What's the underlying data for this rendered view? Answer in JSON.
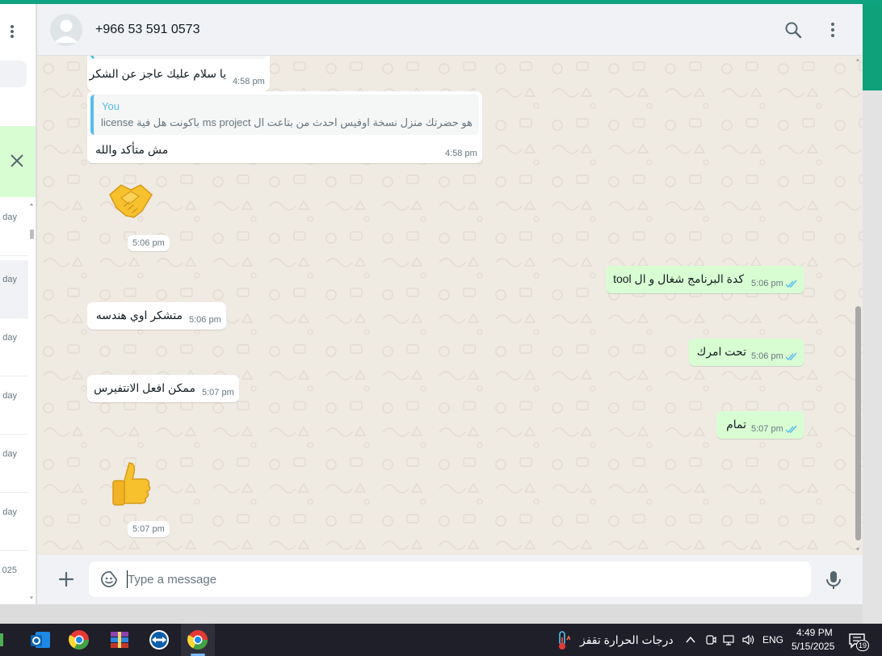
{
  "header": {
    "contact_name": "+966 53 591 0573"
  },
  "sidebar": {
    "dates": [
      "day",
      "day",
      "day",
      "day",
      "day",
      "day",
      "025"
    ]
  },
  "messages": [
    {
      "dir": "in",
      "text": "يا سلام عليك عاجز عن الشكر",
      "time": "4:58 pm"
    },
    {
      "dir": "in",
      "quote_author": "You",
      "quote_text": "هو حضرتك منزل نسخة اوفيس احدث من بتاعت ال ms project باكونت هل فية license",
      "text": "مش متأكد والله",
      "time": "4:58 pm"
    },
    {
      "dir": "in",
      "emoji": "handshake",
      "time": "5:06 pm"
    },
    {
      "dir": "out",
      "text": "كدة البرنامج شغال و ال tool",
      "time": "5:06 pm"
    },
    {
      "dir": "in",
      "text": "متشكر اوي هندسه",
      "time": "5:06 pm"
    },
    {
      "dir": "out",
      "text": "تحت امرك",
      "time": "5:06 pm"
    },
    {
      "dir": "in",
      "text": "ممكن افعل الانتفيرس",
      "time": "5:07 pm"
    },
    {
      "dir": "out",
      "text": "تمام",
      "time": "5:07 pm"
    },
    {
      "dir": "in",
      "emoji": "thumbs-up",
      "time": "5:07 pm"
    }
  ],
  "composer": {
    "placeholder": "Type a message"
  },
  "taskbar": {
    "weather_text": "درجات الحرارة تقفز",
    "language": "ENG",
    "time": "4:49 PM",
    "date": "5/15/2025",
    "notification_count": "19"
  },
  "colors": {
    "accent": "#10a37f",
    "outgoing_bubble": "#d9fdd3",
    "chat_background": "#efeae2",
    "read_ticks": "#53bdeb"
  }
}
